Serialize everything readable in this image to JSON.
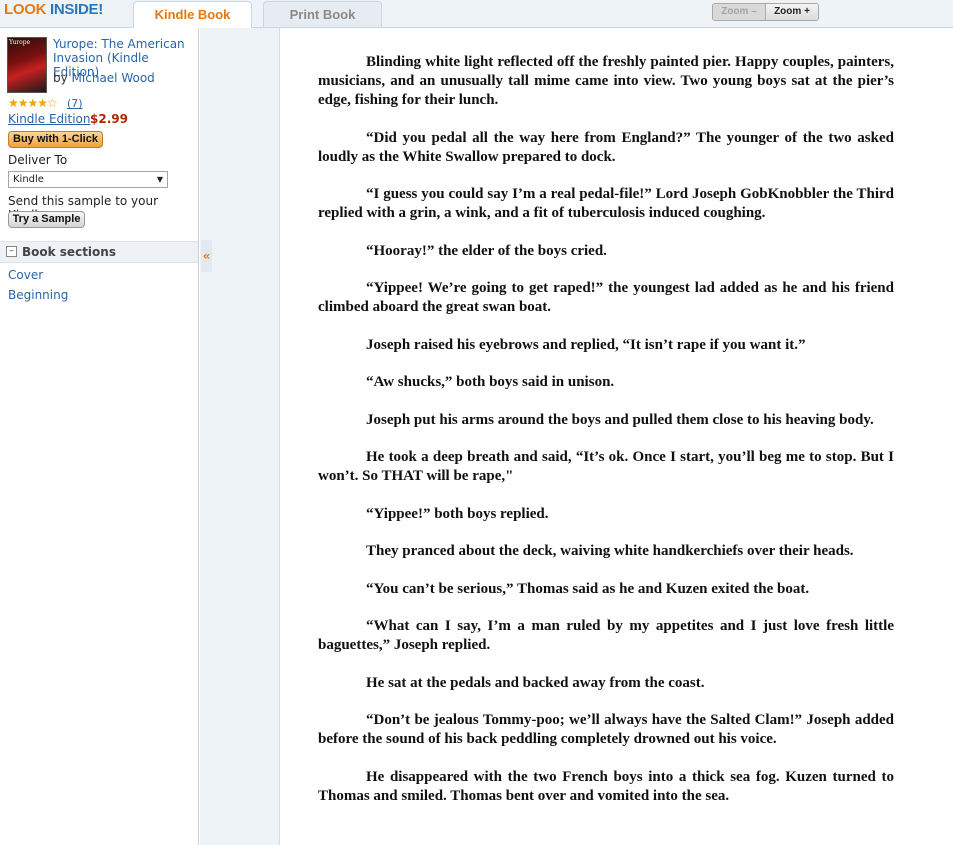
{
  "header": {
    "logo_look": "LOOK",
    "logo_inside": "INSIDE!",
    "tabs": [
      {
        "label": "Kindle Book",
        "active": true
      },
      {
        "label": "Print Book",
        "active": false
      }
    ],
    "zoom_out_label": "Zoom –",
    "zoom_in_label": "Zoom +"
  },
  "sidebar": {
    "cover_text": "Yurope",
    "title": "Yurope: The American Invasion (Kindle Edition)",
    "by_label": "by",
    "author": "Michael Wood",
    "stars": "★★★★☆",
    "rating_count": "(7)",
    "edition": "Kindle Edition",
    "price": "$2.99",
    "buy_button": "Buy with 1-Click",
    "deliver_label": "Deliver To",
    "deliver_value": "Kindle",
    "send_text": "Send this sample to your Kindle",
    "sample_button": "Try a Sample",
    "sections_title": "Book sections",
    "sections": [
      "Cover",
      "Beginning"
    ]
  },
  "colors": {
    "accent_orange": "#e47911",
    "link_blue": "#2a64a7",
    "price_red": "#b12704"
  },
  "reader": {
    "paragraphs": [
      "Blinding white light reflected off the freshly painted pier. Happy couples, painters, musicians, and an unusually tall mime came into view. Two young boys sat at the pier’s edge, fishing for their lunch.",
      "“Did you pedal all the way here from England?” The younger of the two asked loudly as the White Swallow prepared to dock.",
      "“I guess you could say I’m a real pedal-file!” Lord Joseph GobKnobbler the Third replied with a grin, a wink, and a fit of tuberculosis induced coughing.",
      "“Hooray!” the elder of the boys cried.",
      "“Yippee! We’re going to get raped!” the youngest lad added as he and his friend climbed aboard the great swan boat.",
      "Joseph raised his eyebrows and replied, “It isn’t rape if you want it.”",
      "“Aw shucks,” both boys said in unison.",
      "Joseph put his arms around the boys and pulled them close to his heaving body.",
      "He took a deep breath and said, “It’s ok. Once I start, you’ll beg me to stop. But I won’t. So THAT will be rape,\"",
      "“Yippee!” both boys replied.",
      "They pranced about the deck, waiving white handkerchiefs over their heads.",
      "“You can’t be serious,” Thomas said as he and Kuzen exited the boat.",
      "“What can I say, I’m a man ruled by my appetites and I just love fresh little baguettes,” Joseph replied.",
      "He sat at the pedals and backed away from the coast.",
      "“Don’t be jealous Tommy-poo; we’ll always have the Salted Clam!” Joseph added before the sound of his back peddling completely drowned out his voice.",
      "He disappeared with the two French boys into a thick sea fog. Kuzen turned to Thomas and smiled. Thomas bent over and vomited into the sea."
    ]
  }
}
